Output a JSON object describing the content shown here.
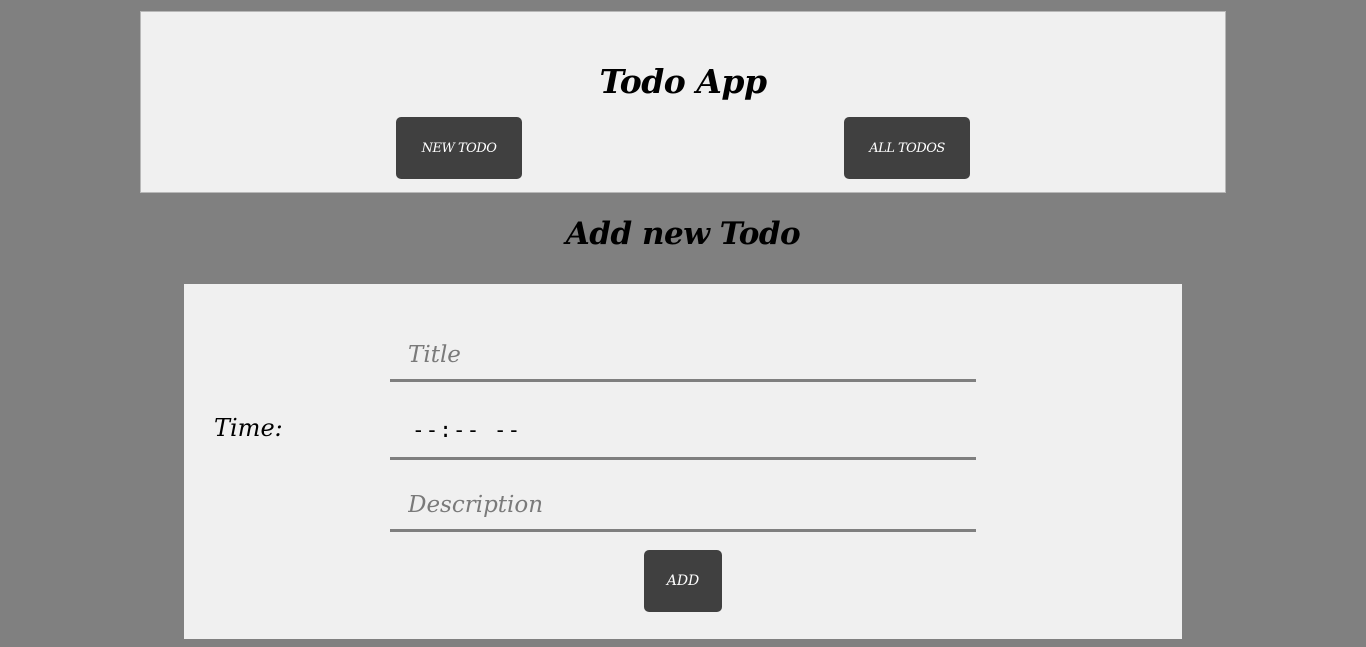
{
  "header": {
    "title": "Todo App",
    "nav": {
      "new_todo_label": "NEW TODO",
      "all_todos_label": "ALL TODOS"
    }
  },
  "form": {
    "heading": "Add new Todo",
    "title_placeholder": "Title",
    "time_label": "Time:",
    "time_value": "--:-- --",
    "description_placeholder": "Description",
    "add_label": "ADD"
  },
  "colors": {
    "page_background": "#808080",
    "panel_background": "#f0f0f0",
    "button_background": "#404040",
    "underline": "#7f7f7f"
  }
}
